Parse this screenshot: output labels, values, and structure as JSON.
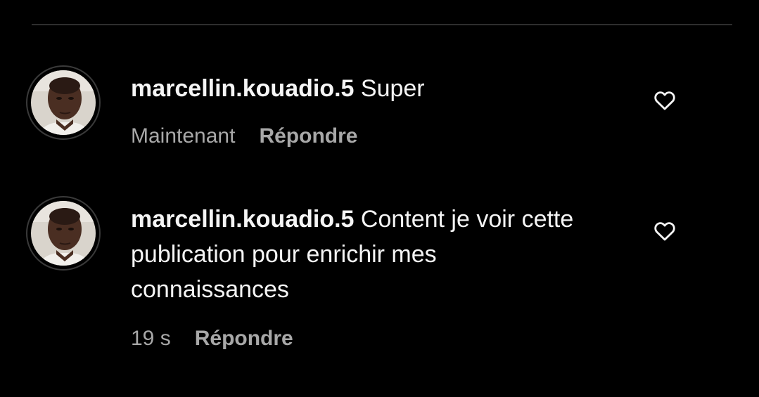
{
  "colors": {
    "background": "#000000",
    "text": "#f5f5f5",
    "secondary_text": "#a8a8a8",
    "divider": "#2e2e2e"
  },
  "comments": [
    {
      "username": "marcellin.kouadio.5",
      "text": "Super",
      "time": "Maintenant",
      "reply_label": "Répondre",
      "avatar_icon": "avatar-photo",
      "like_icon": "heart-outline-icon"
    },
    {
      "username": "marcellin.kouadio.5",
      "text": "Content je voir cette publication pour enrichir mes connaissances",
      "time": "19 s",
      "reply_label": "Répondre",
      "avatar_icon": "avatar-photo",
      "like_icon": "heart-outline-icon"
    }
  ]
}
